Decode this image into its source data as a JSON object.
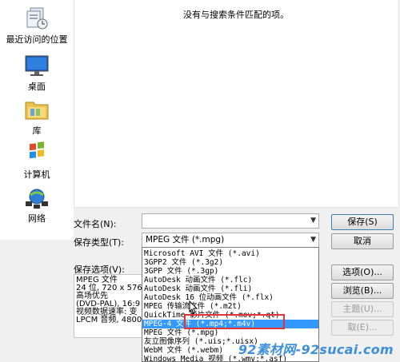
{
  "places": [
    {
      "label": "最近访问的位置",
      "icon": "recent-places-icon"
    },
    {
      "label": "桌面",
      "icon": "desktop-icon"
    },
    {
      "label": "库",
      "icon": "library-folder-icon"
    },
    {
      "label": "计算机",
      "icon": "computer-icon"
    },
    {
      "label": "网络",
      "icon": "network-icon"
    }
  ],
  "file_list": {
    "empty_message": "没有与搜索条件匹配的项。"
  },
  "filename": {
    "label": "文件名(N):",
    "value": ""
  },
  "filetype": {
    "label": "保存类型(T):",
    "value": "MPEG 文件 (*.mpg)"
  },
  "options_label": "保存选项(V):",
  "info_lines": [
    "MPEG 文件",
    "24 位, 720 x 576",
    "高场优先",
    "(DVD-PAL), 16:9",
    "视频数据速率: 变",
    "LPCM 音频, 4800"
  ],
  "buttons": {
    "save": "保存(S)",
    "cancel": "取消",
    "options": "选项(O)...",
    "browse": "浏览(B)...",
    "theme": "主题(U)...",
    "extra": "取(E)..."
  },
  "dropdown": {
    "items": [
      "Microsoft AVI 文件 (*.avi)",
      "3GPP2 文件 (*.3g2)",
      "3GPP 文件 (*.3gp)",
      "AutoDesk 动画文件 (*.flc)",
      "AutoDesk 动画文件 (*.fli)",
      "AutoDesk 16 位动画文件 (*.flx)",
      "MPEG 传输流文件 (*.m2t)",
      "QuickTime 影片文件 (*.mov;*.qt)",
      "MPEG-4 文件 (*.mp4;*.m4v)",
      "MPEG 文件 (*.mpg)",
      "友立图像序列 (*.uis;*.uisx)",
      "WebM 文件 (*.webm)",
      "Windows Media 视频 (*.wmv;*.asf)"
    ],
    "selected_index": 8
  },
  "colors": {
    "selection": "#3399ff",
    "highlight_box": "#e23434",
    "watermark": "#3d8fdb"
  },
  "watermark": "92素材网-92sucai.com"
}
